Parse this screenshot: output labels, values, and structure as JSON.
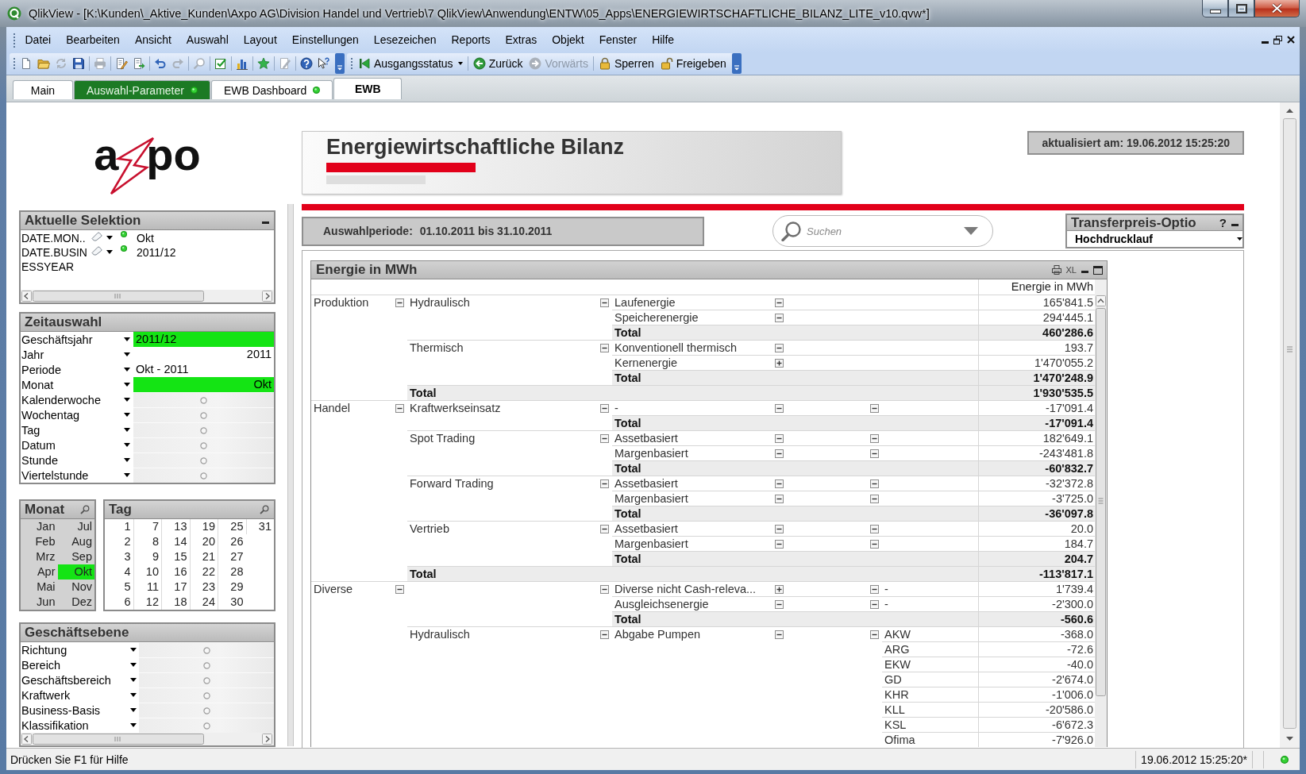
{
  "window": {
    "title": "QlikView - [K:\\Kunden\\_Aktive_Kunden\\Axpo AG\\Division Handel und Vertrieb\\7 QlikView\\Anwendung\\ENTW\\05_Apps\\ENERGIEWIRTSCHAFTLICHE_BILANZ_LITE_v10.qvw*]"
  },
  "menu": [
    "Datei",
    "Bearbeiten",
    "Ansicht",
    "Auswahl",
    "Layout",
    "Einstellungen",
    "Lesezeichen",
    "Reports",
    "Extras",
    "Objekt",
    "Fenster",
    "Hilfe"
  ],
  "toolbar": {
    "tool_groups": [
      [
        {
          "kind": "new",
          "disabled": false
        },
        {
          "kind": "open",
          "disabled": false
        },
        {
          "kind": "refresh",
          "disabled": true
        },
        {
          "kind": "save",
          "disabled": false
        }
      ],
      [
        {
          "kind": "print",
          "disabled": true
        }
      ],
      [
        {
          "kind": "edit_script",
          "disabled": false
        },
        {
          "kind": "reload",
          "disabled": false
        }
      ],
      [
        {
          "kind": "undo",
          "disabled": false
        },
        {
          "kind": "redo",
          "disabled": true
        }
      ],
      [
        {
          "kind": "search",
          "disabled": true
        }
      ],
      [
        {
          "kind": "selections",
          "disabled": false
        }
      ],
      [
        {
          "kind": "chart",
          "disabled": false
        }
      ],
      [
        {
          "kind": "bookmark",
          "disabled": false
        }
      ],
      [
        {
          "kind": "edit",
          "disabled": true
        }
      ],
      [
        {
          "kind": "help",
          "disabled": false
        },
        {
          "kind": "context_help",
          "disabled": false
        }
      ]
    ],
    "navigation_groups": [
      [
        {
          "kind": "reset",
          "label": "Ausgangsstatus",
          "disabled": false
        }
      ],
      [
        {
          "kind": "back",
          "label": "Zurück",
          "disabled": false
        },
        {
          "kind": "forward",
          "label": "Vorwärts",
          "disabled": true
        }
      ],
      [
        {
          "kind": "lock",
          "label": "Sperren",
          "disabled": false
        },
        {
          "kind": "unlock",
          "label": "Freigeben",
          "disabled": false
        }
      ]
    ]
  },
  "tabs": [
    {
      "label": "Main",
      "selected": false,
      "color": "#ffffff",
      "indicator": false
    },
    {
      "label": "Auswahl-Parameter",
      "selected": false,
      "color": "#1c7a24",
      "indicator": true
    },
    {
      "label": "EWB Dashboard",
      "selected": false,
      "color": "#ffffff",
      "indicator": true
    },
    {
      "label": "EWB",
      "selected": true,
      "color": "#ffffff",
      "indicator": false
    }
  ],
  "logo": {
    "lead": "a",
    "tail": "po"
  },
  "current_selections": {
    "title": "Aktuelle Selektion",
    "rows": [
      {
        "field": "DATE.MON..",
        "value": "Okt"
      },
      {
        "field": "DATE.BUSINESSYEAR",
        "value": "2011/12"
      }
    ]
  },
  "time_selection": {
    "title": "Zeitauswahl",
    "rows": [
      {
        "label": "Geschäftsjahr",
        "kind": "text",
        "value": "2011/12",
        "selected": true
      },
      {
        "label": "Jahr",
        "kind": "number",
        "value": "2011",
        "selected": false
      },
      {
        "label": "Periode",
        "kind": "text",
        "value": "Okt - 2011",
        "selected": false
      },
      {
        "label": "Monat",
        "kind": "number",
        "value": "Okt",
        "selected": true
      },
      {
        "label": "Kalenderwoche",
        "kind": "empty",
        "selected": false
      },
      {
        "label": "Wochentag",
        "kind": "empty",
        "selected": false
      },
      {
        "label": "Tag",
        "kind": "empty",
        "selected": false
      },
      {
        "label": "Datum",
        "kind": "empty",
        "selected": false
      },
      {
        "label": "Stunde",
        "kind": "empty",
        "selected": false
      },
      {
        "label": "Viertelstunde",
        "kind": "empty",
        "selected": false
      }
    ]
  },
  "month_list": {
    "title": "Monat",
    "items": [
      {
        "label": "Jan",
        "selected": false,
        "excluded": true
      },
      {
        "label": "Feb",
        "selected": false,
        "excluded": true
      },
      {
        "label": "Mrz",
        "selected": false,
        "excluded": true
      },
      {
        "label": "Apr",
        "selected": false,
        "excluded": true
      },
      {
        "label": "Mai",
        "selected": false,
        "excluded": true
      },
      {
        "label": "Jun",
        "selected": false,
        "excluded": true
      },
      {
        "label": "Jul",
        "selected": false,
        "excluded": true
      },
      {
        "label": "Aug",
        "selected": false,
        "excluded": true
      },
      {
        "label": "Sep",
        "selected": false,
        "excluded": true
      },
      {
        "label": "Okt",
        "selected": true,
        "excluded": false
      },
      {
        "label": "Nov",
        "selected": false,
        "excluded": true
      },
      {
        "label": "Dez",
        "selected": false,
        "excluded": true
      }
    ]
  },
  "day_list": {
    "title": "Tag",
    "items": [
      {
        "label": "1",
        "selected": false,
        "excluded": false
      },
      {
        "label": "2",
        "selected": false,
        "excluded": false
      },
      {
        "label": "3",
        "selected": false,
        "excluded": false
      },
      {
        "label": "4",
        "selected": false,
        "excluded": false
      },
      {
        "label": "5",
        "selected": false,
        "excluded": false
      },
      {
        "label": "6",
        "selected": false,
        "excluded": false
      },
      {
        "label": "7",
        "selected": false,
        "excluded": false
      },
      {
        "label": "8",
        "selected": false,
        "excluded": false
      },
      {
        "label": "9",
        "selected": false,
        "excluded": false
      },
      {
        "label": "10",
        "selected": false,
        "excluded": false
      },
      {
        "label": "11",
        "selected": false,
        "excluded": false
      },
      {
        "label": "12",
        "selected": false,
        "excluded": false
      },
      {
        "label": "13",
        "selected": false,
        "excluded": false
      },
      {
        "label": "14",
        "selected": false,
        "excluded": false
      },
      {
        "label": "15",
        "selected": false,
        "excluded": false
      },
      {
        "label": "16",
        "selected": false,
        "excluded": false
      },
      {
        "label": "17",
        "selected": false,
        "excluded": false
      },
      {
        "label": "18",
        "selected": false,
        "excluded": false
      },
      {
        "label": "19",
        "selected": false,
        "excluded": false
      },
      {
        "label": "20",
        "selected": false,
        "excluded": false
      },
      {
        "label": "21",
        "selected": false,
        "excluded": false
      },
      {
        "label": "22",
        "selected": false,
        "excluded": false
      },
      {
        "label": "23",
        "selected": false,
        "excluded": false
      },
      {
        "label": "24",
        "selected": false,
        "excluded": false
      },
      {
        "label": "25",
        "selected": false,
        "excluded": false
      },
      {
        "label": "26",
        "selected": false,
        "excluded": false
      },
      {
        "label": "27",
        "selected": false,
        "excluded": false
      },
      {
        "label": "28",
        "selected": false,
        "excluded": false
      },
      {
        "label": "29",
        "selected": false,
        "excluded": false
      },
      {
        "label": "30",
        "selected": false,
        "excluded": false
      },
      {
        "label": "31",
        "selected": false,
        "excluded": false
      }
    ]
  },
  "business_level": {
    "title": "Geschäftsebene",
    "rows": [
      {
        "label": "Richtung",
        "kind": "empty",
        "selected": false
      },
      {
        "label": "Bereich",
        "kind": "empty",
        "selected": false
      },
      {
        "label": "Geschäftsbereich",
        "kind": "empty",
        "selected": false
      },
      {
        "label": "Kraftwerk",
        "kind": "empty",
        "selected": false
      },
      {
        "label": "Business-Basis",
        "kind": "empty",
        "selected": false
      },
      {
        "label": "Klassifikation",
        "kind": "empty",
        "selected": false
      }
    ]
  },
  "report": {
    "title": "Energiewirtschaftliche Bilanz",
    "updated": "aktualisiert am: 19.06.2012 15:25:20",
    "period_label": "Auswahlperiode:",
    "period_value": "01.10.2011 bis 31.10.2011"
  },
  "search": {
    "placeholder": "Suchen"
  },
  "transfer_price": {
    "title": "Transferpreis-Optio",
    "help": "?",
    "value": "Hochdrucklauf"
  },
  "pivot": {
    "title": "Energie in MWh",
    "export_label": "XL",
    "value_header": "Energie in MWh",
    "rows": [
      {
        "label": "Produktion",
        "expanded": true,
        "children": [
          {
            "label": "Hydraulisch",
            "expanded": true,
            "children": [
              {
                "label": "Laufenergie",
                "expanded": true,
                "value": "165'841.5"
              },
              {
                "label": "Speicherenergie",
                "expanded": true,
                "value": "294'445.1"
              }
            ],
            "total": {
              "label": "Total",
              "value": "460'286.6"
            }
          },
          {
            "label": "Thermisch",
            "expanded": true,
            "children": [
              {
                "label": "Konventionell thermisch",
                "expanded": true,
                "value": "193.7"
              },
              {
                "label": "Kernenergie",
                "expanded": false,
                "value": "1'470'055.2"
              }
            ],
            "total": {
              "label": "Total",
              "value": "1'470'248.9"
            }
          }
        ],
        "total": {
          "label": "Total",
          "value": "1'930'535.5"
        }
      },
      {
        "label": "Handel",
        "expanded": true,
        "children": [
          {
            "label": "Kraftwerkseinsatz",
            "expanded": true,
            "children": [
              {
                "label": "-",
                "expanded": true,
                "children": [
                  {
                    "expanded": true,
                    "value": "-17'091.4"
                  }
                ]
              }
            ],
            "total": {
              "label": "Total",
              "value": "-17'091.4"
            }
          },
          {
            "label": "Spot Trading",
            "expanded": true,
            "children": [
              {
                "label": "Assetbasiert",
                "expanded": true,
                "children": [
                  {
                    "expanded": true,
                    "value": "182'649.1"
                  }
                ]
              },
              {
                "label": "Margenbasiert",
                "expanded": true,
                "children": [
                  {
                    "expanded": true,
                    "value": "-243'481.8"
                  }
                ]
              }
            ],
            "total": {
              "label": "Total",
              "value": "-60'832.7"
            }
          },
          {
            "label": "Forward Trading",
            "expanded": true,
            "children": [
              {
                "label": "Assetbasiert",
                "expanded": true,
                "children": [
                  {
                    "expanded": true,
                    "value": "-32'372.8"
                  }
                ]
              },
              {
                "label": "Margenbasiert",
                "expanded": true,
                "children": [
                  {
                    "expanded": true,
                    "value": "-3'725.0"
                  }
                ]
              }
            ],
            "total": {
              "label": "Total",
              "value": "-36'097.8"
            }
          },
          {
            "label": "Vertrieb",
            "expanded": true,
            "children": [
              {
                "label": "Assetbasiert",
                "expanded": true,
                "children": [
                  {
                    "expanded": true,
                    "value": "20.0"
                  }
                ]
              },
              {
                "label": "Margenbasiert",
                "expanded": true,
                "children": [
                  {
                    "expanded": true,
                    "value": "184.7"
                  }
                ]
              }
            ],
            "total": {
              "label": "Total",
              "value": "204.7"
            }
          }
        ],
        "total": {
          "label": "Total",
          "value": "-113'817.1"
        }
      },
      {
        "label": "Diverse",
        "expanded": true,
        "children": [
          {
            "expanded": true,
            "children": [
              {
                "label": "Diverse nicht Cash-releva...",
                "expanded": false,
                "children": [
                  {
                    "expanded": true,
                    "children": [
                      {
                        "label": "-",
                        "value": "1'739.4"
                      }
                    ]
                  }
                ]
              },
              {
                "label": "Ausgleichsenergie",
                "expanded": true,
                "children": [
                  {
                    "expanded": true,
                    "children": [
                      {
                        "label": "-",
                        "value": "-2'300.0"
                      }
                    ]
                  }
                ]
              }
            ],
            "total": {
              "label": "Total",
              "value": "-560.6"
            }
          },
          {
            "label": "Hydraulisch",
            "expanded": true,
            "children": [
              {
                "label": "Abgabe Pumpen",
                "expanded": true,
                "children": [
                  {
                    "expanded": true,
                    "children": [
                      {
                        "label": "AKW",
                        "value": "-368.0"
                      },
                      {
                        "label": "ARG",
                        "value": "-72.6"
                      },
                      {
                        "label": "EKW",
                        "value": "-40.0"
                      },
                      {
                        "label": "GD",
                        "value": "-2'674.0"
                      },
                      {
                        "label": "KHR",
                        "value": "-1'006.0"
                      },
                      {
                        "label": "KLL",
                        "value": "-20'586.0"
                      },
                      {
                        "label": "KSL",
                        "value": "-6'672.3"
                      },
                      {
                        "label": "Ofima",
                        "value": "-7'926.0"
                      }
                    ]
                  }
                ]
              }
            ]
          }
        ]
      }
    ]
  },
  "status_bar": {
    "hint": "Drücken Sie F1 für Hilfe",
    "timestamp": "19.06.2012 15:25:20*"
  }
}
